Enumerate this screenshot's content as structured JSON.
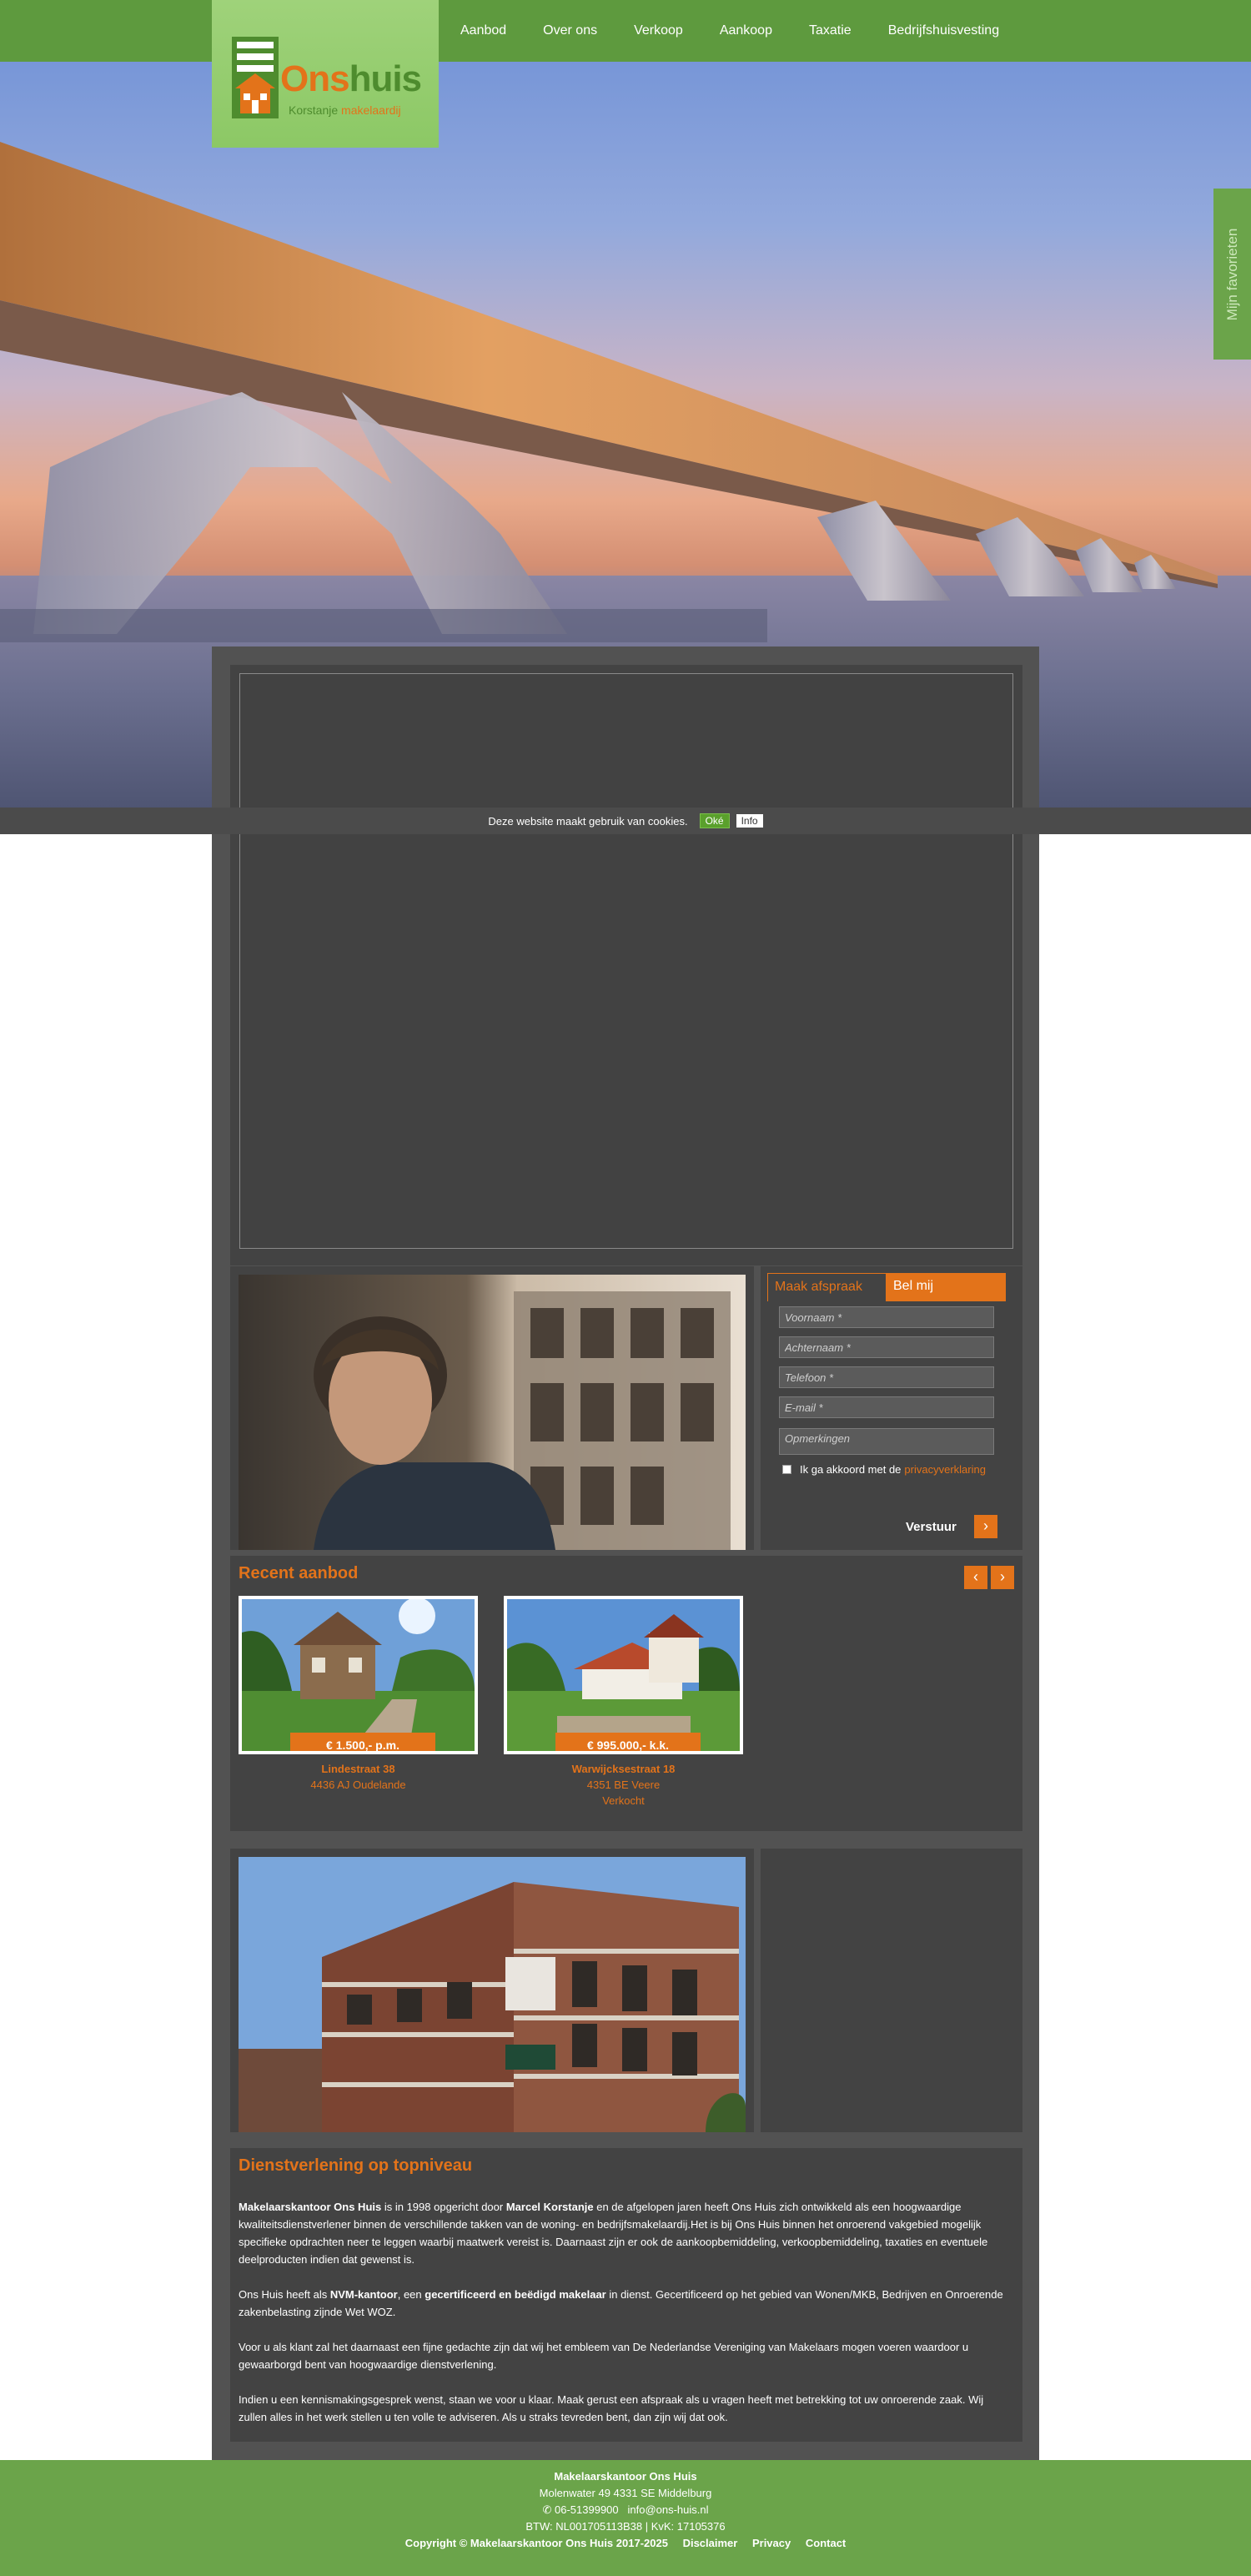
{
  "brand": {
    "name_part1": "Ons",
    "name_part2": "huis",
    "sub_part1": "Korstanje",
    "sub_part2": "makelaardij"
  },
  "nav": {
    "items": [
      {
        "label": "Aanbod"
      },
      {
        "label": "Over ons"
      },
      {
        "label": "Verkoop"
      },
      {
        "label": "Aankoop"
      },
      {
        "label": "Taxatie"
      },
      {
        "label": "Bedrijfshuisvesting"
      }
    ]
  },
  "favorites_tab": "Mijn favorieten",
  "cookie_bar": {
    "text": "Deze website maakt gebruik van cookies.",
    "ok_label": "Oké",
    "info_label": "Info"
  },
  "appointment_form": {
    "tab_active": "Maak afspraak",
    "tab_other": "Bel mij",
    "fields": {
      "first_name": "Voornaam *",
      "last_name": "Achternaam *",
      "phone": "Telefoon *",
      "email": "E-mail *",
      "remarks": "Opmerkingen"
    },
    "agree_text": "Ik ga akkoord met de",
    "agree_link": "privacyverklaring",
    "submit_label": "Verstuur",
    "submit_icon": "chevron-right-icon"
  },
  "recent": {
    "title": "Recent aanbod",
    "prev_icon": "chevron-left-icon",
    "next_icon": "chevron-right-icon",
    "listings": [
      {
        "price": "€ 1.500,- p.m.",
        "street": "Lindestraat 38",
        "city": "4436 AJ Oudelande",
        "status": ""
      },
      {
        "price": "€ 995.000,- k.k.",
        "street": "Warwijcksestraat 18",
        "city": "4351 BE Veere",
        "status": "Verkocht"
      }
    ]
  },
  "services": {
    "title": "Dienstverlening op topniveau",
    "p1": {
      "b1": "Makelaarskantoor Ons Huis",
      "t1": " is in 1998 opgericht door ",
      "b2": "Marcel Korstanje",
      "t2": " en de afgelopen jaren heeft Ons Huis zich ontwikkeld als een hoogwaardige kwaliteitsdienstverlener binnen de verschillende takken van de woning- en bedrijfsmakelaardij.Het is bij Ons Huis binnen het onroerend vakgebied mogelijk specifieke opdrachten neer te leggen waarbij maatwerk vereist is. Daarnaast zijn er ook de aankoopbemiddeling, verkoopbemiddeling, taxaties en eventuele deelproducten indien dat gewenst is."
    },
    "p2": {
      "t1": "Ons Huis heeft als ",
      "b1": "NVM-kantoor",
      "t2": ", een ",
      "b2": "gecertificeerd en beëdigd makelaar",
      "t3": " in dienst. Gecertificeerd op het gebied van Wonen/MKB, Bedrijven en Onroerende zakenbelasting zijnde Wet WOZ."
    },
    "p3": "Voor u als klant zal het daarnaast een fijne gedachte zijn dat wij het embleem van De Nederlandse Vereniging van Makelaars mogen voeren waardoor u gewaarborgd bent van hoogwaardige dienstverlening.",
    "p4": "Indien u een kennismakingsgesprek wenst, staan we voor u klaar. Maak gerust een afspraak als u vragen heeft met betrekking tot uw onroerende zaak. Wij zullen alles in het werk stellen u ten volle te adviseren. Als u straks tevreden bent, dan zijn wij dat ook."
  },
  "footer": {
    "company": "Makelaarskantoor Ons Huis",
    "address": "Molenwater 49   4331 SE Middelburg",
    "phone_icon": "phone-icon",
    "phone": "06-51399900",
    "email": "info@ons-huis.nl",
    "registration": "BTW: NL001705113B38 | KvK: 17105376",
    "copyright": "Copyright © Makelaarskantoor Ons Huis 2017-2025",
    "links": [
      "Disclaimer",
      "Privacy",
      "Contact"
    ]
  },
  "colors": {
    "green_nav": "#5e9a3e",
    "green_footer": "#6ba44a",
    "orange_accent": "#e3731a",
    "dark_panel": "#434343",
    "container": "#525252"
  }
}
